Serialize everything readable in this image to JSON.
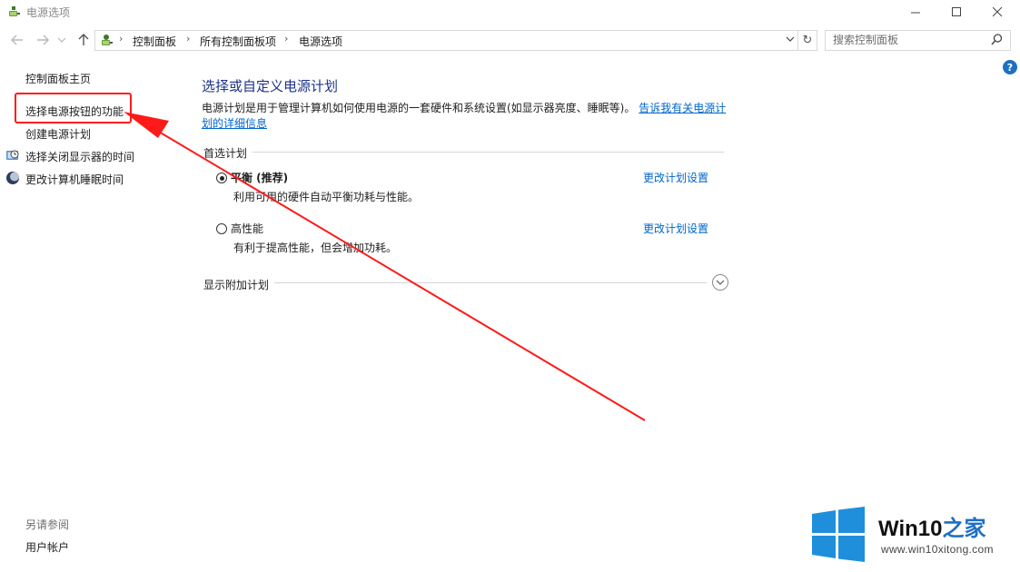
{
  "window": {
    "title": "电源选项"
  },
  "nav": {
    "breadcrumbs": [
      "控制面板",
      "所有控制面板项",
      "电源选项"
    ],
    "search_placeholder": "搜索控制面板"
  },
  "sidebar": {
    "items": [
      {
        "label": "控制面板主页",
        "icon": null
      },
      {
        "label": "选择电源按钮的功能",
        "icon": null
      },
      {
        "label": "创建电源计划",
        "icon": null
      },
      {
        "label": "选择关闭显示器的时间",
        "icon": "monitor-clock-icon"
      },
      {
        "label": "更改计算机睡眠时间",
        "icon": "moon-icon"
      }
    ],
    "see_also_title": "另请参阅",
    "see_also_items": [
      "用户帐户"
    ]
  },
  "main": {
    "title": "选择或自定义电源计划",
    "description": "电源计划是用于管理计算机如何使用电源的一套硬件和系统设置(如显示器亮度、睡眠等)。",
    "description_link": "告诉我有关电源计划的详细信息",
    "preferred_plans_heading": "首选计划",
    "plans": [
      {
        "name": "平衡 (推荐)",
        "description": "利用可用的硬件自动平衡功耗与性能。",
        "selected": true,
        "link": "更改计划设置"
      },
      {
        "name": "高性能",
        "description": "有利于提高性能，但会增加功耗。",
        "selected": false,
        "link": "更改计划设置"
      }
    ],
    "additional_plans_heading": "显示附加计划"
  },
  "watermark": {
    "brand_main": "Win10",
    "brand_accent": "之家",
    "url": "www.win10xitong.com",
    "logo_color": "#1f8fdc"
  },
  "annotation": {
    "color": "#ff1a1a"
  }
}
